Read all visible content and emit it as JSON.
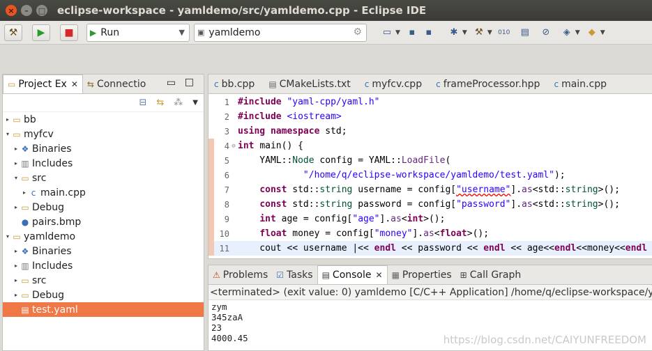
{
  "window": {
    "title": "eclipse-workspace - yamldemo/src/yamldemo.cpp - Eclipse IDE"
  },
  "toolbar": {
    "run_combo": "Run",
    "project_combo": "yamldemo"
  },
  "left": {
    "tabs": [
      {
        "label": "Project Ex"
      },
      {
        "label": "Connectio"
      }
    ],
    "tree": [
      {
        "label": "bb",
        "indent": 0,
        "twisty": "▸",
        "icon": "folder"
      },
      {
        "label": "myfcv",
        "indent": 0,
        "twisty": "▾",
        "icon": "folder"
      },
      {
        "label": "Binaries",
        "indent": 1,
        "twisty": "▸",
        "icon": "binaries"
      },
      {
        "label": "Includes",
        "indent": 1,
        "twisty": "▸",
        "icon": "includes"
      },
      {
        "label": "src",
        "indent": 1,
        "twisty": "▾",
        "icon": "folder"
      },
      {
        "label": "main.cpp",
        "indent": 2,
        "twisty": "▸",
        "icon": "cfile"
      },
      {
        "label": "Debug",
        "indent": 1,
        "twisty": "▸",
        "icon": "folder"
      },
      {
        "label": "pairs.bmp",
        "indent": 1,
        "twisty": "",
        "icon": "image"
      },
      {
        "label": "yamldemo",
        "indent": 0,
        "twisty": "▾",
        "icon": "folder"
      },
      {
        "label": "Binaries",
        "indent": 1,
        "twisty": "▸",
        "icon": "binaries"
      },
      {
        "label": "Includes",
        "indent": 1,
        "twisty": "▸",
        "icon": "includes"
      },
      {
        "label": "src",
        "indent": 1,
        "twisty": "▸",
        "icon": "folder"
      },
      {
        "label": "Debug",
        "indent": 1,
        "twisty": "▸",
        "icon": "folder"
      },
      {
        "label": "test.yaml",
        "indent": 1,
        "twisty": "",
        "icon": "file",
        "selected": true
      }
    ]
  },
  "editor": {
    "tabs": [
      {
        "label": "bb.cpp"
      },
      {
        "label": "CMakeLists.txt"
      },
      {
        "label": "myfcv.cpp"
      },
      {
        "label": "frameProcessor.hpp"
      },
      {
        "label": "main.cpp"
      }
    ],
    "lines": [
      {
        "no": "1",
        "tokens": [
          [
            "kw",
            "#include "
          ],
          [
            "str",
            "\"yaml-cpp/yaml.h\""
          ]
        ]
      },
      {
        "no": "2",
        "tokens": [
          [
            "kw",
            "#include "
          ],
          [
            "str",
            "<iostream>"
          ]
        ]
      },
      {
        "no": "3",
        "tokens": [
          [
            "kw",
            "using namespace"
          ],
          [
            "src",
            " std;"
          ]
        ]
      },
      {
        "no": "4",
        "fold": "⊖",
        "marker": true,
        "tokens": [
          [
            "kw",
            "int"
          ],
          [
            "src",
            " "
          ],
          [
            "src",
            "main() {"
          ]
        ]
      },
      {
        "no": "5",
        "marker": true,
        "tokens": [
          [
            "src",
            "    YAML::"
          ],
          [
            "ns",
            "Node"
          ],
          [
            "src",
            " config = YAML::"
          ],
          [
            "fn",
            "LoadFile"
          ],
          [
            "src",
            "("
          ]
        ]
      },
      {
        "no": "6",
        "marker": true,
        "tokens": [
          [
            "src",
            "            "
          ],
          [
            "str",
            "\"/home/q/eclipse-workspace/yamldemo/test.yaml\""
          ],
          [
            "src",
            ");"
          ]
        ]
      },
      {
        "no": "7",
        "marker": true,
        "tokens": [
          [
            "src",
            "    "
          ],
          [
            "kw",
            "const"
          ],
          [
            "src",
            " std::"
          ],
          [
            "ns",
            "string"
          ],
          [
            "src",
            " username = config["
          ],
          [
            "strsq",
            "\"username\""
          ],
          [
            "src",
            "]."
          ],
          [
            "fn",
            "as"
          ],
          [
            "src",
            "<std::"
          ],
          [
            "ns",
            "string"
          ],
          [
            "src",
            ">();"
          ]
        ]
      },
      {
        "no": "8",
        "marker": true,
        "tokens": [
          [
            "src",
            "    "
          ],
          [
            "kw",
            "const"
          ],
          [
            "src",
            " std::"
          ],
          [
            "ns",
            "string"
          ],
          [
            "src",
            " password = config["
          ],
          [
            "str",
            "\"password\""
          ],
          [
            "src",
            "]."
          ],
          [
            "fn",
            "as"
          ],
          [
            "src",
            "<std::"
          ],
          [
            "ns",
            "string"
          ],
          [
            "src",
            ">();"
          ]
        ]
      },
      {
        "no": "9",
        "marker": true,
        "tokens": [
          [
            "src",
            "    "
          ],
          [
            "kw",
            "int"
          ],
          [
            "src",
            " age = config["
          ],
          [
            "str",
            "\"age\""
          ],
          [
            "src",
            "]."
          ],
          [
            "fn",
            "as"
          ],
          [
            "src",
            "<"
          ],
          [
            "kw",
            "int"
          ],
          [
            "src",
            ">();"
          ]
        ]
      },
      {
        "no": "10",
        "marker": true,
        "tokens": [
          [
            "src",
            "    "
          ],
          [
            "kw",
            "float"
          ],
          [
            "src",
            " money = config["
          ],
          [
            "str",
            "\"money\""
          ],
          [
            "src",
            "]."
          ],
          [
            "fn",
            "as"
          ],
          [
            "src",
            "<"
          ],
          [
            "kw",
            "float"
          ],
          [
            "src",
            ">();"
          ]
        ]
      },
      {
        "no": "11",
        "marker": true,
        "current": true,
        "tokens": [
          [
            "src",
            "    cout << username |<< "
          ],
          [
            "kw",
            "endl"
          ],
          [
            "src",
            " << password << "
          ],
          [
            "kw",
            "endl"
          ],
          [
            "src",
            " << age<<"
          ],
          [
            "kw",
            "endl"
          ],
          [
            "src",
            "<<money<<"
          ],
          [
            "kw",
            "endl"
          ]
        ]
      }
    ]
  },
  "bottom": {
    "tabs": [
      {
        "label": "Problems"
      },
      {
        "label": "Tasks"
      },
      {
        "label": "Console"
      },
      {
        "label": "Properties"
      },
      {
        "label": "Call Graph"
      }
    ],
    "status": "<terminated> (exit value: 0) yamldemo [C/C++ Application] /home/q/eclipse-workspace/yamldemo/Debug/yamldemo",
    "output": [
      "zym",
      "345zaA",
      "23",
      "4000.45"
    ]
  },
  "watermark": "https://blog.csdn.net/CAIYUNFREEDOM",
  "colors": {
    "selection": "#f07746",
    "title_bar": "#3b3a36",
    "keyword": "#7f0055",
    "string": "#2a00ff"
  }
}
